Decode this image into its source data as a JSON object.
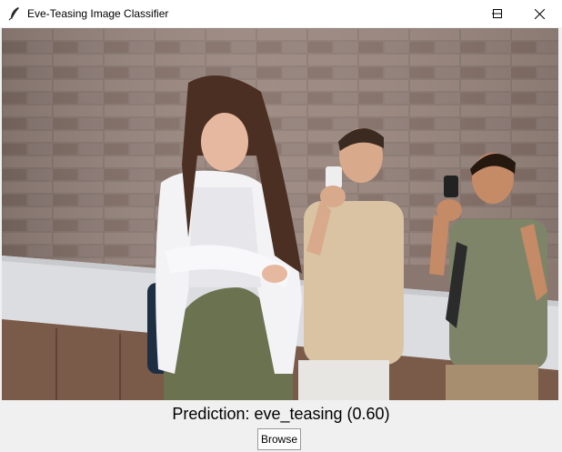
{
  "window": {
    "title": "Eve-Teasing Image Classifier",
    "icon": "feather-icon",
    "controls": [
      "minimize-icon",
      "maximize-icon",
      "close-icon"
    ]
  },
  "image": {
    "name": "uploaded-photo"
  },
  "result": {
    "prediction_text": "Prediction: eve_teasing (0.60)"
  },
  "actions": {
    "browse_label": "Browse"
  }
}
